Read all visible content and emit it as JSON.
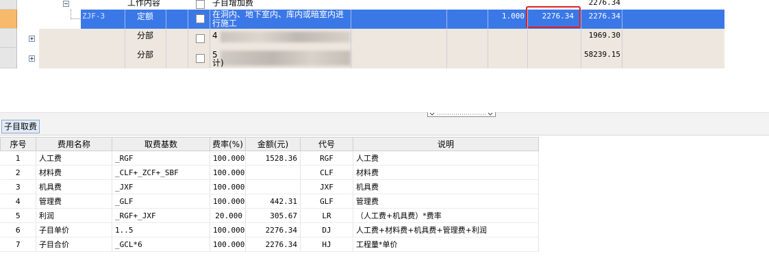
{
  "top_grid": {
    "row_content": {
      "type": "工作内容",
      "name": "子目增加费",
      "total": "2276.34"
    },
    "row_selected": {
      "code": "ZJF-3",
      "type": "定额",
      "name_line1": "在洞内、地下室内、库内或暗室内进",
      "name_line2": "行施工",
      "qty": "1.000",
      "price": "2276.34",
      "total": "2276.34"
    },
    "row_part1": {
      "type": "分部",
      "name_prefix": "4",
      "total": "1969.30"
    },
    "row_part2": {
      "type": "分部",
      "name_prefix": "5",
      "name_suffix": "计)",
      "total": "58239.15"
    }
  },
  "tabs": {
    "active": "子目取费"
  },
  "fee_table": {
    "headers": [
      "序号",
      "费用名称",
      "取费基数",
      "费率(%)",
      "金额(元)",
      "代号",
      "说明"
    ],
    "rows": [
      [
        "1",
        "人工费",
        "_RGF",
        "100.000",
        "1528.36",
        "RGF",
        "人工费"
      ],
      [
        "2",
        "材料费",
        "_CLF+_ZCF+_SBF",
        "100.000",
        "",
        "CLF",
        "材料费"
      ],
      [
        "3",
        "机具费",
        "_JXF",
        "100.000",
        "",
        "JXF",
        "机具费"
      ],
      [
        "4",
        "管理费",
        "_GLF",
        "100.000",
        "442.31",
        "GLF",
        "管理费"
      ],
      [
        "5",
        "利润",
        "_RGF+_JXF",
        "20.000",
        "305.67",
        "LR",
        "（人工费+机具费）*费率"
      ],
      [
        "6",
        "子目单价",
        "1..5",
        "100.000",
        "2276.34",
        "DJ",
        "人工费+材料费+机具费+管理费+利润"
      ],
      [
        "7",
        "子目合价",
        "_GCL*6",
        "100.000",
        "2276.34",
        "HJ",
        "工程量*单价"
      ]
    ]
  },
  "colors": {
    "selection": "#3b78e7",
    "highlight_box": "#e02020",
    "part_row": "#ede7df",
    "row_header_selected": "#f7b96a"
  }
}
